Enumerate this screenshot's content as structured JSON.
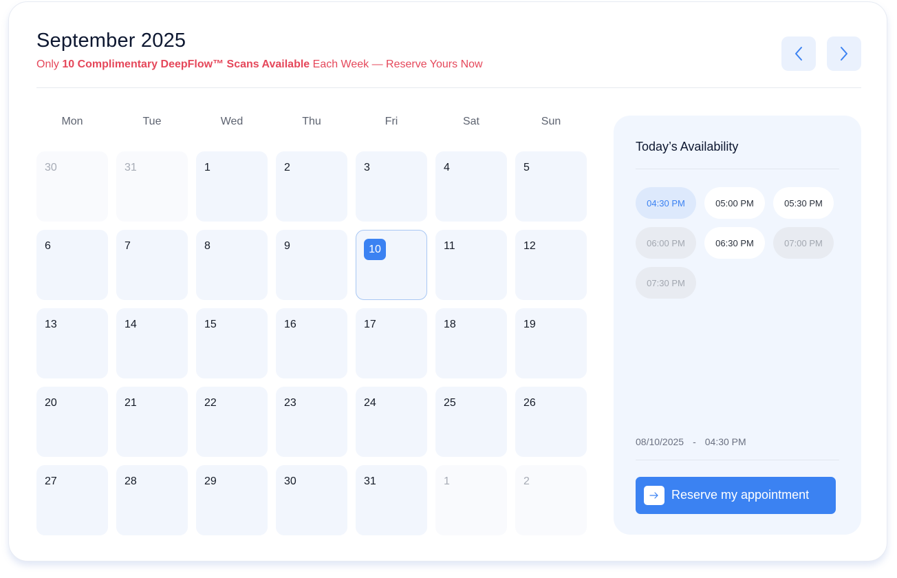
{
  "header": {
    "month_title": "September 2025",
    "promo": {
      "prefix": "Only",
      "highlight": "10 Complimentary DeepFlow™ Scans Available",
      "suffix": "Each Week — Reserve Yours Now"
    },
    "prev_icon": "chevron-left-icon",
    "next_icon": "chevron-right-icon"
  },
  "weekdays": [
    "Mon",
    "Tue",
    "Wed",
    "Thu",
    "Fri",
    "Sat",
    "Sun"
  ],
  "calendar": {
    "selected_day": 10,
    "weeks": [
      [
        {
          "label": "30",
          "muted": true
        },
        {
          "label": "31",
          "muted": true
        },
        {
          "label": "1"
        },
        {
          "label": "2"
        },
        {
          "label": "3"
        },
        {
          "label": "4"
        },
        {
          "label": "5"
        }
      ],
      [
        {
          "label": "6"
        },
        {
          "label": "7"
        },
        {
          "label": "8"
        },
        {
          "label": "9"
        },
        {
          "label": "10",
          "selected": true
        },
        {
          "label": "11"
        },
        {
          "label": "12"
        }
      ],
      [
        {
          "label": "13"
        },
        {
          "label": "14"
        },
        {
          "label": "15"
        },
        {
          "label": "16"
        },
        {
          "label": "17"
        },
        {
          "label": "18"
        },
        {
          "label": "19"
        }
      ],
      [
        {
          "label": "20"
        },
        {
          "label": "21"
        },
        {
          "label": "22"
        },
        {
          "label": "23"
        },
        {
          "label": "24"
        },
        {
          "label": "25"
        },
        {
          "label": "26"
        }
      ],
      [
        {
          "label": "27"
        },
        {
          "label": "28"
        },
        {
          "label": "29"
        },
        {
          "label": "30"
        },
        {
          "label": "31"
        },
        {
          "label": "1",
          "muted": true
        },
        {
          "label": "2",
          "muted": true
        }
      ]
    ]
  },
  "availability": {
    "title": "Today’s Availability",
    "slots": [
      {
        "time": "04:30 PM",
        "state": "selected"
      },
      {
        "time": "05:00 PM",
        "state": "available"
      },
      {
        "time": "05:30 PM",
        "state": "available"
      },
      {
        "time": "06:00 PM",
        "state": "unavailable"
      },
      {
        "time": "06:30 PM",
        "state": "available"
      },
      {
        "time": "07:00 PM",
        "state": "unavailable"
      },
      {
        "time": "07:30 PM",
        "state": "unavailable"
      }
    ],
    "summary_date": "08/10/2025",
    "summary_separator": "-",
    "summary_time": "04:30 PM",
    "reserve_label": "Reserve my appointment",
    "reserve_icon": "arrow-right-icon"
  },
  "colors": {
    "accent": "#3b82f2",
    "promo": "#e5475a",
    "day_bg": "#f2f6fd",
    "panel_bg": "#f1f6fe"
  }
}
